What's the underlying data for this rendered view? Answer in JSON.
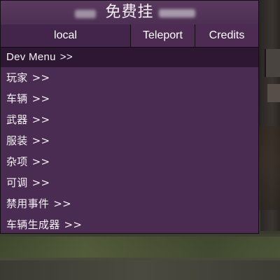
{
  "header": {
    "title": "免费挂"
  },
  "tabs": [
    {
      "label": "local",
      "active": true
    },
    {
      "label": "Teleport",
      "active": false
    },
    {
      "label": "Credits",
      "active": false
    }
  ],
  "menu": {
    "items": [
      {
        "label": "Dev Menu",
        "suffix": ">>",
        "selected": true
      },
      {
        "label": "玩家",
        "suffix": ">>"
      },
      {
        "label": "车辆",
        "suffix": ">>"
      },
      {
        "label": "武器",
        "suffix": ">>"
      },
      {
        "label": "服装",
        "suffix": ">>"
      },
      {
        "label": "杂项",
        "suffix": ">>"
      },
      {
        "label": "可调",
        "suffix": ">>"
      },
      {
        "label": "禁用事件",
        "suffix": ">>"
      },
      {
        "label": "车辆生成器",
        "suffix": ">>"
      }
    ]
  },
  "colors": {
    "menu_bg": "#4a2b52",
    "selected_row": "#2e1733",
    "text": "#f6f2f6"
  }
}
